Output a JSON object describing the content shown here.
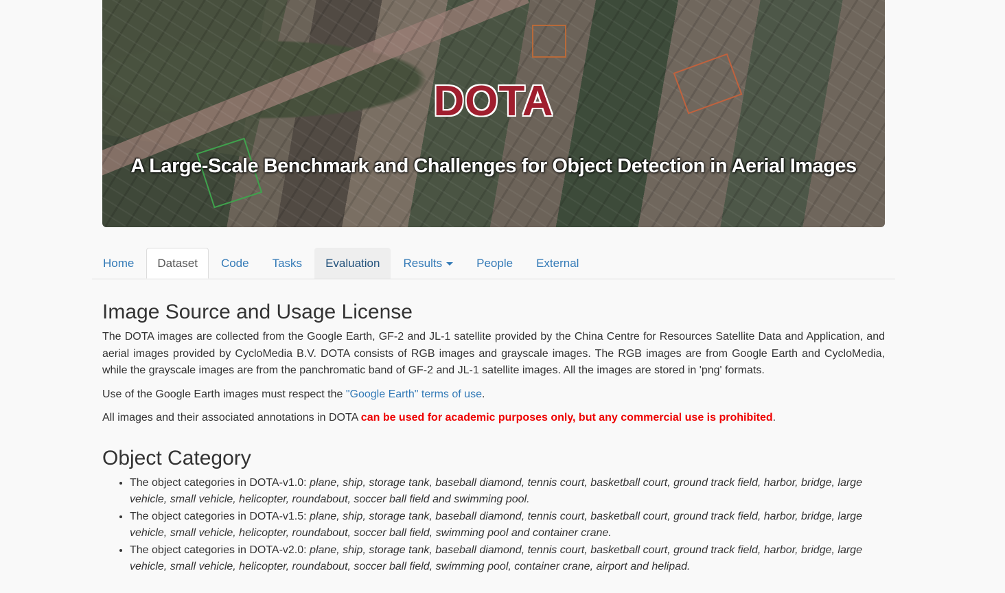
{
  "banner": {
    "logo_text": "DOTA",
    "subtitle": "A Large-Scale Benchmark and Challenges for Object Detection in Aerial Images"
  },
  "nav": {
    "tabs": [
      {
        "label": "Home"
      },
      {
        "label": "Dataset"
      },
      {
        "label": "Code"
      },
      {
        "label": "Tasks"
      },
      {
        "label": "Evaluation"
      },
      {
        "label": "Results"
      },
      {
        "label": "People"
      },
      {
        "label": "External"
      }
    ],
    "active_tab": "Dataset",
    "hovered_tab": "Evaluation"
  },
  "section1": {
    "heading": "Image Source and Usage License",
    "para1": "The DOTA images are collected from the Google Earth, GF-2 and JL-1 satellite provided by the China Centre for Resources Satellite Data and Application, and aerial images provided by CycloMedia B.V. DOTA consists of RGB images and grayscale images. The RGB images are from Google Earth and CycloMedia, while the grayscale images are from the panchromatic band of GF-2 and JL-1 satellite images. All the images are stored in 'png' formats.",
    "para2_prefix": "Use of the Google Earth images must respect the ",
    "para2_link": "\"Google Earth\" terms of use",
    "para2_suffix": ".",
    "para3_prefix": "All images and their associated annotations in DOTA ",
    "para3_warning": "can be used for academic purposes only, but any commercial use is prohibited",
    "para3_suffix": "."
  },
  "section2": {
    "heading": "Object Category",
    "items": [
      {
        "prefix": "The object categories in DOTA-v1.0: ",
        "list": "plane, ship, storage tank, baseball diamond, tennis court, basketball court, ground track field, harbor, bridge, large vehicle, small vehicle, helicopter, roundabout, soccer ball field and swimming pool."
      },
      {
        "prefix": "The object categories in DOTA-v1.5: ",
        "list": "plane, ship, storage tank, baseball diamond, tennis court, basketball court, ground track field, harbor, bridge, large vehicle, small vehicle, helicopter, roundabout, soccer ball field, swimming pool and container crane."
      },
      {
        "prefix": "The object categories in DOTA-v2.0: ",
        "list": "plane, ship, storage tank, baseball diamond, tennis court, basketball court, ground track field, harbor, bridge, large vehicle, small vehicle, helicopter, roundabout, soccer ball field, swimming pool, container crane, airport and helipad."
      }
    ]
  }
}
